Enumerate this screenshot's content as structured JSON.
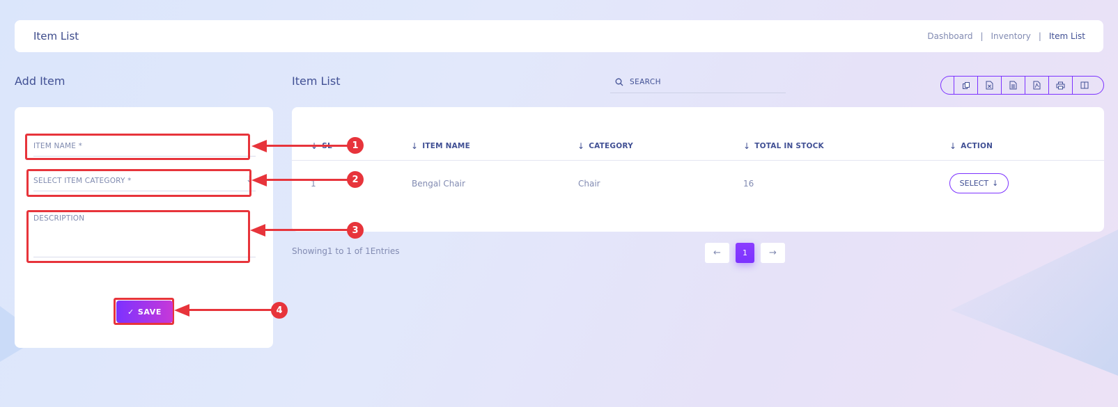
{
  "header": {
    "title": "Item List",
    "breadcrumb": [
      "Dashboard",
      "Inventory",
      "Item List"
    ],
    "separator": "|"
  },
  "add_item": {
    "title": "Add Item",
    "item_name_placeholder": "ITEM NAME *",
    "category_placeholder": "SELECT ITEM CATEGORY *",
    "description_placeholder": "DESCRIPTION",
    "save_label": "SAVE",
    "save_icon": "✓"
  },
  "item_list": {
    "title": "Item List",
    "search_placeholder": "SEARCH",
    "export_buttons": [
      "copy-icon",
      "excel-icon",
      "csv-icon",
      "pdf-icon",
      "print-icon",
      "columns-icon"
    ],
    "columns": [
      "SL",
      "ITEM NAME",
      "CATEGORY",
      "TOTAL IN STOCK",
      "ACTION"
    ],
    "rows": [
      {
        "sl": "1",
        "item_name": "Bengal Chair",
        "category": "Chair",
        "total_in_stock": "16",
        "action": "SELECT"
      }
    ],
    "showing": "Showing1 to 1 of 1Entries",
    "pagination": {
      "prev": "←",
      "current": "1",
      "next": "→"
    }
  },
  "annotations": [
    "1",
    "2",
    "3",
    "4"
  ],
  "colors": {
    "accent": "#7c32ff",
    "gradient_end": "#c738d8",
    "annotation": "#e7343b",
    "text": "#415094"
  }
}
